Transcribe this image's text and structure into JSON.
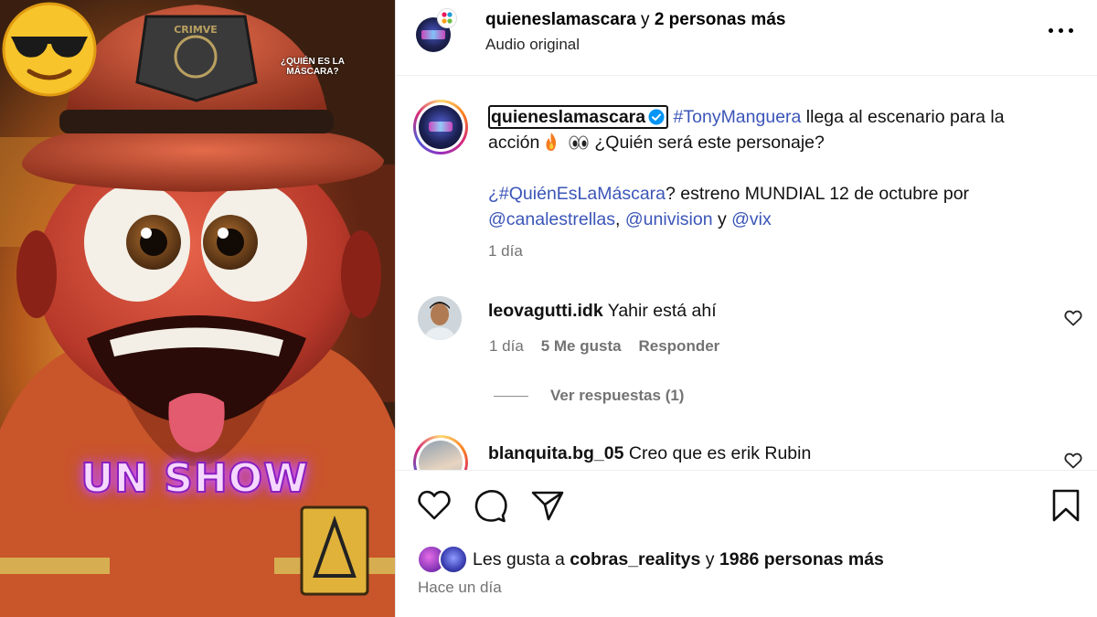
{
  "media": {
    "overlay_text": "¿QUIÉN ES LA MÁSCARA?",
    "caption_text": "UN SHOW",
    "helmet_badge_text": "CRIMVE"
  },
  "header": {
    "username": "quieneslamascara",
    "collab_text": "y",
    "collab_count": "2 personas más",
    "audio": "Audio original"
  },
  "caption": {
    "username": "quieneslamascara",
    "hashtag1": "#TonyManguera",
    "text1": "llega al escenario para la acción",
    "text2": "¿Quién será este personaje?",
    "hashtag2": "¿#QuiénEsLaMáscara",
    "text3": "? estreno MUNDIAL 12 de octubre por",
    "mention1": "@canalestrellas",
    "sep": ",",
    "mention2": "@univision",
    "and": "y",
    "mention3": "@vix",
    "time": "1 día"
  },
  "comments": [
    {
      "username": "leovagutti.idk",
      "text": "Yahir está ahí",
      "time": "1 día",
      "likes": "5 Me gusta",
      "reply": "Responder",
      "view_replies": "Ver respuestas (1)"
    },
    {
      "username": "blanquita.bg_05",
      "text": "Creo que es erik Rubin"
    }
  ],
  "likes": {
    "prefix": "Les gusta a",
    "user": "cobras_realitys",
    "and": "y",
    "others": "1986 personas más"
  },
  "post_time": "Hace un día",
  "colors": {
    "link": "#3b55b8",
    "muted": "#737373",
    "verified": "#0095f6"
  }
}
